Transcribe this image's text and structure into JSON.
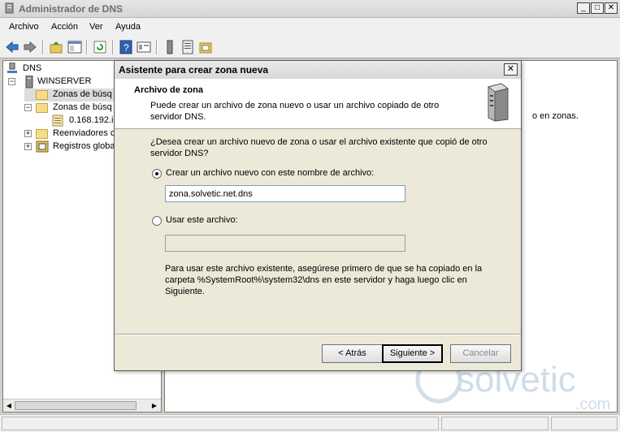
{
  "window": {
    "title": "Administrador de DNS",
    "minimize_glyph": "_",
    "maximize_glyph": "□",
    "close_glyph": "✕"
  },
  "menu": [
    "Archivo",
    "Acción",
    "Ver",
    "Ayuda"
  ],
  "toolbar": {
    "icons": [
      "back-arrow-icon",
      "forward-arrow-icon",
      "up-folder-icon",
      "show-hide-tree-icon",
      "refresh-icon",
      "help-icon",
      "properties-icon",
      "server-icon",
      "list-icon",
      "zone-icon"
    ]
  },
  "tree": {
    "root": "DNS",
    "server": "WINSERVER",
    "items": [
      {
        "label": "Zonas de búsq"
      },
      {
        "label": "Zonas de búsq"
      },
      {
        "label": "0.168.192.i"
      },
      {
        "label": "Reenviadores c"
      },
      {
        "label": "Registros globa"
      }
    ]
  },
  "detail": {
    "text": "o en zonas."
  },
  "dialog": {
    "title": "Asistente para crear zona nueva",
    "close_glyph": "✕",
    "header_title": "Archivo de zona",
    "header_desc": "Puede crear un archivo de zona nuevo o usar un archivo copiado de otro servidor DNS.",
    "question": "¿Desea crear un archivo nuevo de zona o usar el archivo existente que copió de otro servidor DNS?",
    "option_new": {
      "label": "Crear un archivo nuevo con este nombre de archivo:",
      "value": "zona.solvetic.net.dns",
      "checked": true
    },
    "option_existing": {
      "label": "Usar este archivo:",
      "value": "",
      "checked": false
    },
    "note": "Para usar este archivo existente, asegúrese primero de que se ha copiado en la carpeta %SystemRoot%\\system32\\dns en este servidor y haga luego clic en Siguiente.",
    "back_label": "< Atrás",
    "next_label": "Siguiente >",
    "cancel_label": "Cancelar"
  },
  "watermark": {
    "text": "solvetic",
    "suffix": ".com"
  },
  "colors": {
    "title_text": "#6e6e6e",
    "dialog_bg": "#ece9d8",
    "input_border": "#7f9db9"
  }
}
